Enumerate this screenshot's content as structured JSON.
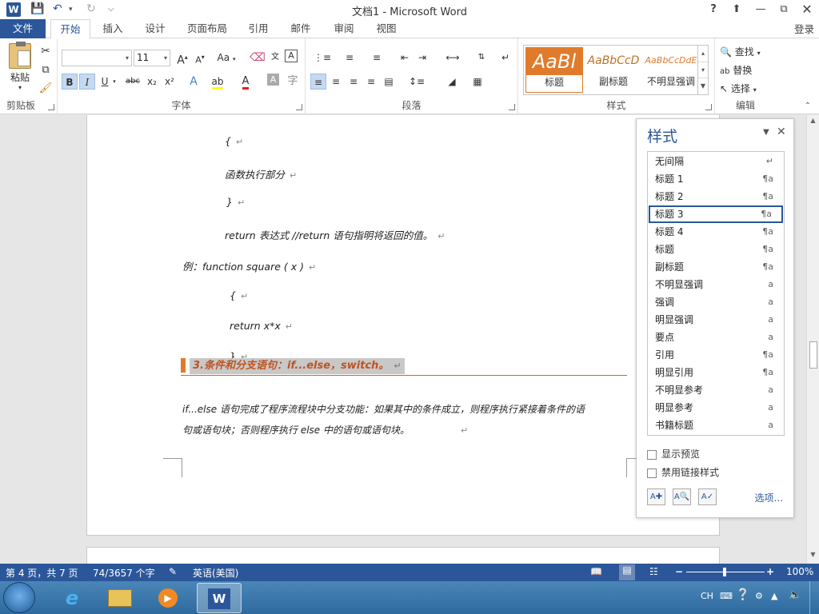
{
  "window": {
    "title": "文档1 - Microsoft Word",
    "app_icon": "W",
    "help": "?",
    "controls": [
      "restore-ribbon",
      "minimize",
      "maximize",
      "close"
    ]
  },
  "tabs": [
    "文件",
    "开始",
    "插入",
    "设计",
    "页面布局",
    "引用",
    "邮件",
    "审阅",
    "视图"
  ],
  "active_tab": "开始",
  "login": "登录",
  "ribbon": {
    "clipboard": {
      "label": "剪贴板",
      "paste": "粘贴"
    },
    "font": {
      "label": "字体",
      "font_name": "",
      "font_size": "11",
      "bold": "B",
      "italic": "I",
      "underline": "U",
      "strike": "abc",
      "sub": "x₂",
      "sup": "x²",
      "grow": "A",
      "shrink": "A",
      "case": "Aa",
      "color_a": "A"
    },
    "paragraph": {
      "label": "段落"
    },
    "styles": {
      "label": "样式",
      "gallery": [
        {
          "sample": "AaBl",
          "name": "标题"
        },
        {
          "sample": "AaBbCcD",
          "name": "副标题"
        },
        {
          "sample": "AaBbCcDdE",
          "name": "不明显强调"
        }
      ]
    },
    "editing": {
      "label": "编辑",
      "find": "查找",
      "replace": "替换",
      "select": "选择"
    }
  },
  "document": {
    "lines": [
      "{",
      "函数执行部分",
      "}",
      "return  表达式 //return 语句指明将返回的值。",
      "例：function square ( x )",
      "{",
      "return x*x",
      "}"
    ],
    "heading": "3.条件和分支语句：if...else，switch。",
    "paragraph_line1": "if...else 语句完成了程序流程块中分支功能：如果其中的条件成立，则程序执行紧接着条件的语",
    "paragraph_line2": "句或语句块；否则程序执行 else 中的语句或语句块。",
    "return_mark": "↵"
  },
  "styles_pane": {
    "title": "样式",
    "items": [
      {
        "name": "无间隔",
        "mark": "↵"
      },
      {
        "name": "标题 1",
        "mark": "¶a"
      },
      {
        "name": "标题 2",
        "mark": "¶a"
      },
      {
        "name": "标题 3",
        "mark": "¶a"
      },
      {
        "name": "标题 4",
        "mark": "¶a"
      },
      {
        "name": "标题",
        "mark": "¶a"
      },
      {
        "name": "副标题",
        "mark": "¶a"
      },
      {
        "name": "不明显强调",
        "mark": "a"
      },
      {
        "name": "强调",
        "mark": "a"
      },
      {
        "name": "明显强调",
        "mark": "a"
      },
      {
        "name": "要点",
        "mark": "a"
      },
      {
        "name": "引用",
        "mark": "¶a"
      },
      {
        "name": "明显引用",
        "mark": "¶a"
      },
      {
        "name": "不明显参考",
        "mark": "a"
      },
      {
        "name": "明显参考",
        "mark": "a"
      },
      {
        "name": "书籍标题",
        "mark": "a"
      }
    ],
    "selected": "标题 3",
    "show_preview": "显示预览",
    "disable_linked": "禁用链接样式",
    "options": "选项..."
  },
  "status": {
    "page": "第 4 页，共 7 页",
    "words": "74/3657 个字",
    "language": "英语(美国)",
    "zoom": "100%",
    "zoom_minus": "−",
    "zoom_plus": "+"
  },
  "tray": {
    "ime": "CH"
  },
  "colors": {
    "word_blue": "#2b579a",
    "heading_orange": "#c0531e"
  }
}
